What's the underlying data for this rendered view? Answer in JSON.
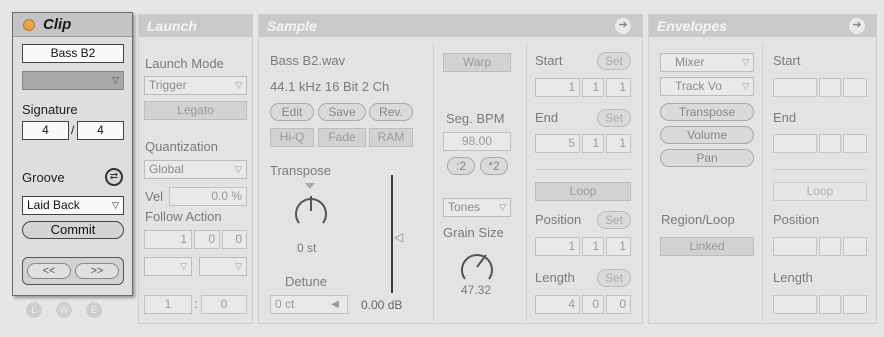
{
  "clip": {
    "title": "Clip",
    "name": "Bass B2",
    "signature_label": "Signature",
    "sig_num": "4",
    "sig_sep": "/",
    "sig_den": "4",
    "groove_label": "Groove",
    "groove_value": "Laid Back",
    "commit": "Commit",
    "nudge_back": "<<",
    "nudge_fwd": ">>",
    "toggles": [
      "L",
      "W",
      "E"
    ]
  },
  "launch": {
    "title": "Launch",
    "mode_label": "Launch Mode",
    "mode_value": "Trigger",
    "legato": "Legato",
    "quant_label": "Quantization",
    "quant_value": "Global",
    "vel_label": "Vel",
    "vel_value": "0.0 %",
    "follow_label": "Follow Action",
    "follow_vals": [
      "1",
      "0",
      "0"
    ],
    "chance_a": "1",
    "chance_sep": ":",
    "chance_b": "0"
  },
  "sample": {
    "title": "Sample",
    "file": "Bass B2.wav",
    "info": "44.1 kHz 16 Bit 2 Ch",
    "edit": "Edit",
    "save": "Save",
    "rev": "Rev.",
    "hiq": "Hi-Q",
    "fade": "Fade",
    "ram": "RAM",
    "transpose_label": "Transpose",
    "transpose_value": "0 st",
    "detune_label": "Detune",
    "detune_value": "0 ct",
    "gain_value": "0.00 dB",
    "warp": "Warp",
    "segbpm_label": "Seg. BPM",
    "segbpm_value": "98.00",
    "half": ":2",
    "double": "*2",
    "warp_mode": "Tones",
    "grain_label": "Grain Size",
    "grain_value": "47.32",
    "start_label": "Start",
    "end_label": "End",
    "set": "Set",
    "start_vals": [
      "1",
      "1",
      "1"
    ],
    "end_vals": [
      "5",
      "1",
      "1"
    ],
    "loop": "Loop",
    "position_label": "Position",
    "position_vals": [
      "1",
      "1",
      "1"
    ],
    "length_label": "Length",
    "length_vals": [
      "4",
      "0",
      "0"
    ]
  },
  "envelopes": {
    "title": "Envelopes",
    "device": "Mixer",
    "control": "Track Vo",
    "transpose": "Transpose",
    "volume": "Volume",
    "pan": "Pan",
    "region_label": "Region/Loop",
    "linked": "Linked",
    "start_label": "Start",
    "end_label": "End",
    "loop": "Loop",
    "position_label": "Position",
    "length_label": "Length"
  }
}
